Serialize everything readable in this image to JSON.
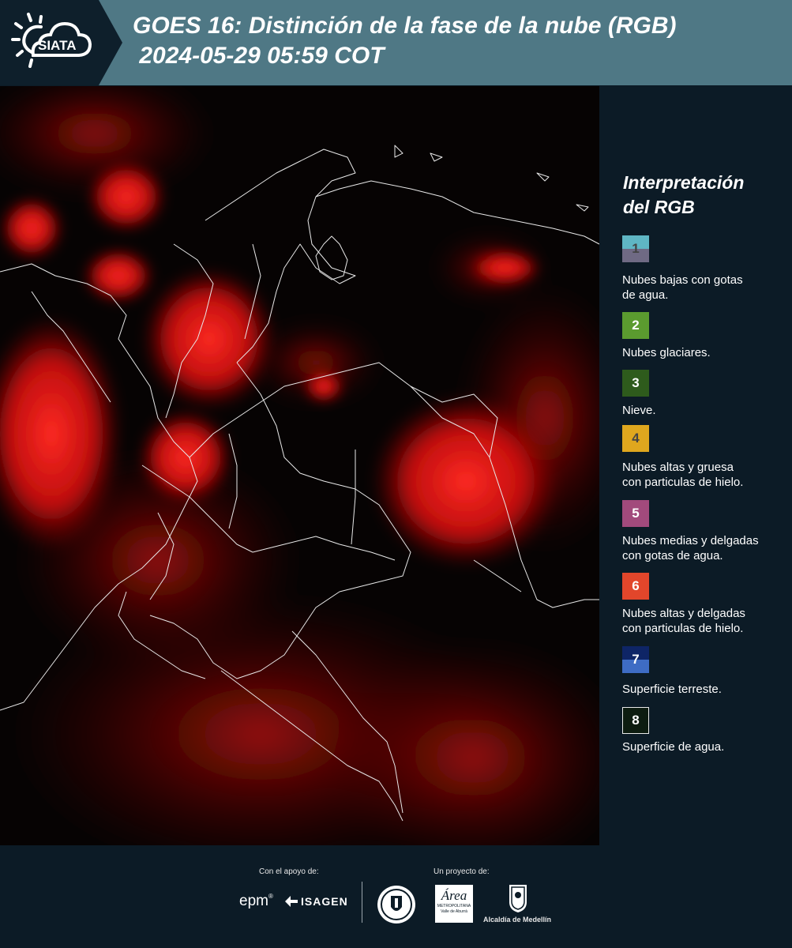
{
  "header": {
    "title_line1": "GOES 16: Distinción de la fase de la nube (RGB)",
    "title_line2": " 2024-05-29 05:59 COT",
    "logo_text": "SIATA"
  },
  "legend": {
    "title_line1": "Interpretación",
    "title_line2": "del RGB",
    "items": [
      {
        "num": "1",
        "label_line1": "Nubes bajas con gotas",
        "label_line2": "de agua.",
        "color_top": "#5fb6c4",
        "color_bottom": "#6f6a84"
      },
      {
        "num": "2",
        "label_line1": "Nubes glaciares.",
        "label_line2": "",
        "color_top": "#5b9b2f",
        "color_bottom": "#5b9b2f"
      },
      {
        "num": "3",
        "label_line1": "Nieve.",
        "label_line2": "",
        "color_top": "#2e5b1c",
        "color_bottom": "#2e5b1c"
      },
      {
        "num": "4",
        "label_line1": "Nubes altas y gruesa",
        "label_line2": "con particulas de hielo.",
        "color_top": "#dfa71e",
        "color_bottom": "#dfa71e"
      },
      {
        "num": "5",
        "label_line1": "Nubes medias y delgadas",
        "label_line2": "con gotas de agua.",
        "color_top": "#a24a7c",
        "color_bottom": "#a24a7c"
      },
      {
        "num": "6",
        "label_line1": "Nubes altas y delgadas",
        "label_line2": "con particulas de hielo.",
        "color_top": "#e2462b",
        "color_bottom": "#e2462b"
      },
      {
        "num": "7",
        "label_line1": "Superficie terreste.",
        "label_line2": "",
        "color_top": "#0e2566",
        "color_bottom": "#3e6cc4"
      },
      {
        "num": "8",
        "label_line1": "Superficie de agua.",
        "label_line2": "",
        "color_top": "#0d1c10",
        "color_bottom": "#0d1c10"
      }
    ]
  },
  "footer": {
    "support_label": "Con el apoyo de:",
    "project_label": "Un proyecto de:",
    "epm": "epm",
    "isagen": "ISAGEN",
    "metropolitana": "METROPOLITANA",
    "valle": "Valle de Aburrá",
    "area": "Área",
    "alcaldia": "Alcaldía de Medellín"
  }
}
